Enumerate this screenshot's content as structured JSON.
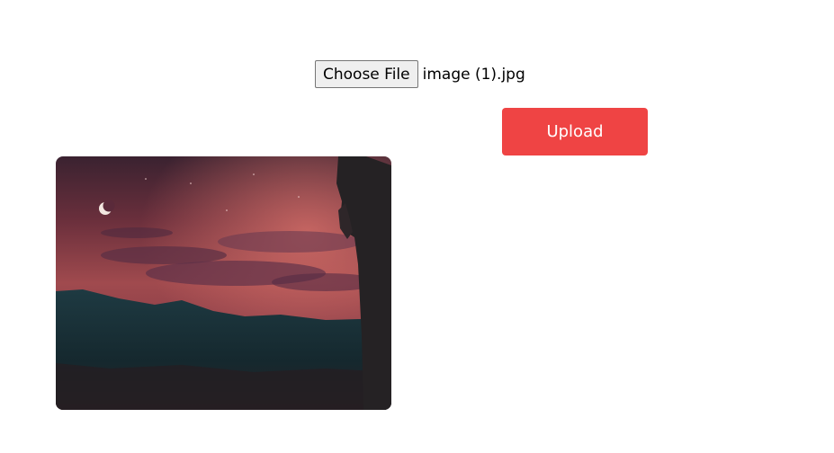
{
  "file_input": {
    "button_label": "Choose File",
    "selected_file": "image (1).jpg"
  },
  "upload": {
    "label": "Upload",
    "color": "#ef4444"
  },
  "preview": {
    "icon": "uploaded-photo-preview"
  }
}
